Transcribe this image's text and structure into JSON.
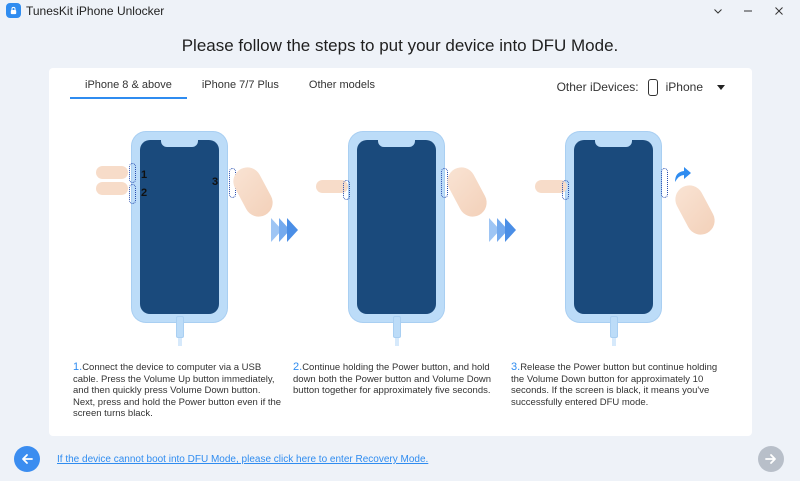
{
  "window": {
    "title": "TunesKit iPhone Unlocker",
    "logo_icon": "lock-icon",
    "controls": [
      "chevron-down-icon",
      "minimize-icon",
      "close-icon"
    ]
  },
  "headline": "Please follow the steps to put your device into DFU Mode.",
  "tabs": [
    {
      "label": "iPhone 8 & above",
      "active": true
    },
    {
      "label": "iPhone 7/7 Plus",
      "active": false
    },
    {
      "label": "Other models",
      "active": false
    }
  ],
  "device_picker": {
    "label": "Other iDevices:",
    "icon": "phone-icon",
    "selected": "iPhone"
  },
  "illustration": {
    "step1_markers": [
      "1",
      "2",
      "3"
    ]
  },
  "steps": [
    {
      "number": "1.",
      "text": "Connect the device to computer via a USB cable. Press the Volume Up button immediately, and then quickly press Volume Down button. Next, press and hold the Power button even if the screen turns black."
    },
    {
      "number": "2.",
      "text": "Continue holding the Power button, and hold down both the Power button and Volume Down button together for approximately five seconds."
    },
    {
      "number": "3.",
      "text": "Release the Power button but continue holding the Volume Down button for approximately 10 seconds. If the screen is black, it means you've successfully entered DFU mode."
    }
  ],
  "footer": {
    "recovery_link": "If the device cannot boot into DFU Mode, please click here to enter Recovery Mode.",
    "back_icon": "arrow-left-icon",
    "next_icon": "arrow-right-icon"
  },
  "colors": {
    "accent": "#2f8cf0",
    "phone_body": "#bcdcf8",
    "phone_screen": "#1a4a7c",
    "next_disabled": "#b8bfc9"
  }
}
